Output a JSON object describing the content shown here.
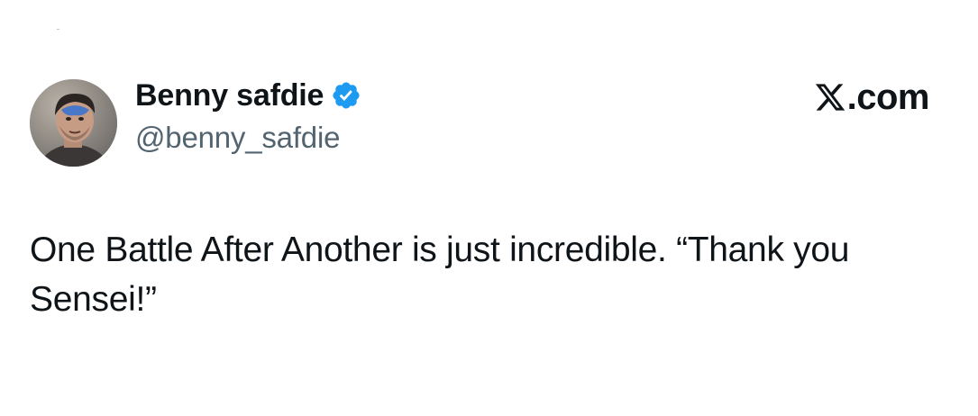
{
  "author": {
    "display_name": "Benny safdie",
    "handle": "@benny_safdie",
    "verified": true,
    "verified_icon": "verified-badge-icon",
    "avatar_icon": "profile-photo"
  },
  "brand": {
    "label": ".com",
    "logo_icon": "x-logo-icon"
  },
  "tweet": {
    "text": "One Battle After Another is just incredible. “Thank you Sensei!”"
  },
  "colors": {
    "text_primary": "#0f1419",
    "text_secondary": "#536471",
    "verified_blue": "#1d9bf0",
    "background": "#ffffff"
  }
}
